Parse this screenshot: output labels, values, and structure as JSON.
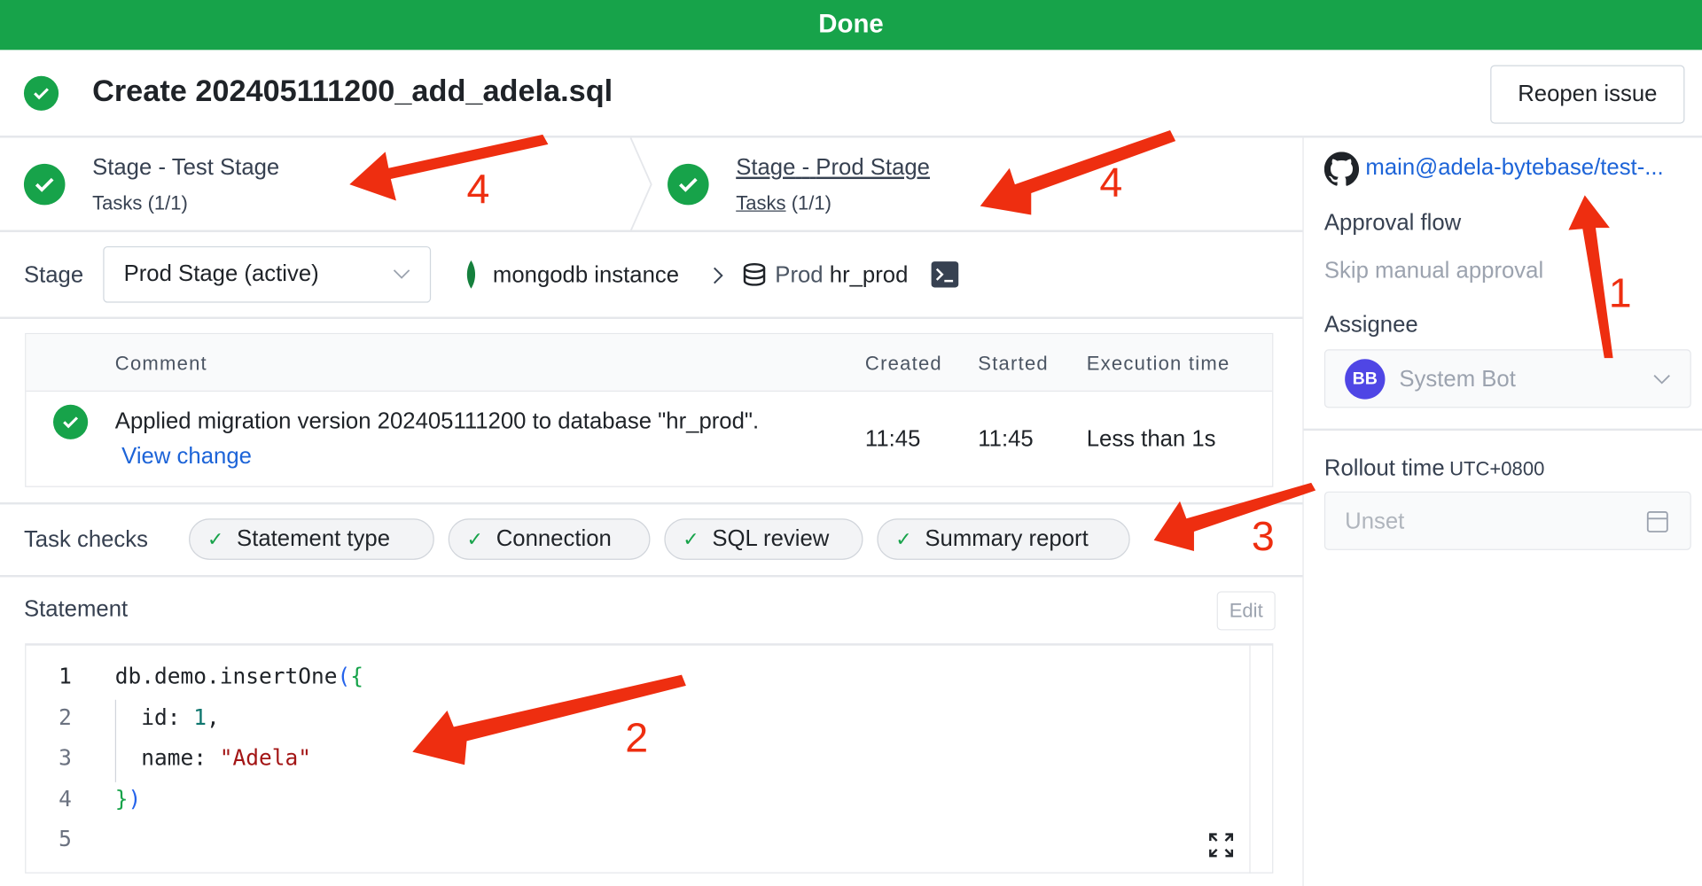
{
  "banner": {
    "status": "Done",
    "color": "#17a34a"
  },
  "header": {
    "title": "Create 202405111200_add_adela.sql",
    "reopen_label": "Reopen issue"
  },
  "stages": [
    {
      "prefix": "Stage",
      "sep": "-",
      "name": "Test Stage",
      "tasks": "Tasks",
      "count": "(1/1)"
    },
    {
      "prefix": "Stage",
      "sep": "-",
      "name": "Prod Stage",
      "tasks": "Tasks",
      "count": "(1/1)"
    }
  ],
  "stage_bar": {
    "label": "Stage",
    "selected": "Prod Stage (active)",
    "instance": "mongodb instance",
    "env": "Prod",
    "database": "hr_prod"
  },
  "task_table": {
    "headers": [
      "Comment",
      "Created",
      "Started",
      "Execution time"
    ],
    "rows": [
      {
        "comment": "Applied migration version 202405111200 to database \"hr_prod\".",
        "link": "View change",
        "created": "11:45",
        "started": "11:45",
        "execution": "Less than 1s"
      }
    ]
  },
  "task_checks": {
    "label": "Task checks",
    "items": [
      "Statement type",
      "Connection",
      "SQL review",
      "Summary report"
    ]
  },
  "statement": {
    "label": "Statement",
    "edit_label": "Edit",
    "lines": [
      {
        "n": "1",
        "parts": [
          [
            "db.demo.insertOne",
            "#1f2328"
          ],
          [
            "(",
            "#2563eb"
          ],
          [
            "{",
            "#16a34a"
          ]
        ]
      },
      {
        "n": "2",
        "parts": [
          [
            "  id: ",
            "#1f2328"
          ],
          [
            "1",
            "#0f766e"
          ],
          [
            ",",
            "#1f2328"
          ]
        ]
      },
      {
        "n": "3",
        "parts": [
          [
            "  name: ",
            "#1f2328"
          ],
          [
            "\"Adela\"",
            "#a31515"
          ]
        ]
      },
      {
        "n": "4",
        "parts": [
          [
            "}",
            "#16a34a"
          ],
          [
            ")",
            "#2563eb"
          ]
        ]
      },
      {
        "n": "5",
        "parts": []
      }
    ]
  },
  "sidebar": {
    "branch": "main@adela-bytebase/test-...",
    "approval_flow_label": "Approval flow",
    "approval_flow_value": "Skip manual approval",
    "assignee_label": "Assignee",
    "assignee_initials": "BB",
    "assignee_name": "System Bot",
    "rollout_label": "Rollout time",
    "rollout_tz": "UTC+0800",
    "rollout_placeholder": "Unset"
  },
  "annotations": [
    "1",
    "2",
    "3",
    "4",
    "4"
  ]
}
